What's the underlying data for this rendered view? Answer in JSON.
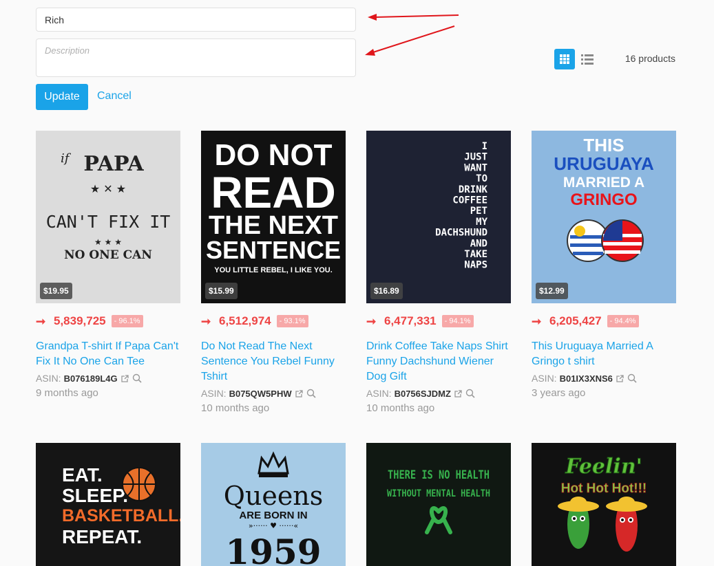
{
  "form": {
    "name_value": "Rich",
    "description_placeholder": "Description",
    "update_label": "Update",
    "cancel_label": "Cancel"
  },
  "toolbar": {
    "grid_icon": "grid-icon",
    "list_icon": "list-icon",
    "product_count": "16 products"
  },
  "colors": {
    "accent": "#1aa3e8",
    "rank_red": "#ee4444",
    "badge_pink": "#f7a8a8",
    "annotation_arrow": "#e0161b"
  },
  "products": [
    {
      "price": "$19.95",
      "rank": "5,839,725",
      "rank_change": "- 96.1%",
      "title": "Grandpa T-shirt If Papa Can't Fix It No One Can Tee",
      "asin_label": "ASIN:",
      "asin": "B076189L4G",
      "time_ago": "9 months ago",
      "art": {
        "if": "if",
        "papa": "PAPA",
        "cant": "CAN'T FIX IT",
        "no_one": "NO ONE CAN"
      }
    },
    {
      "price": "$15.99",
      "rank": "6,512,974",
      "rank_change": "- 93.1%",
      "title": "Do Not Read The Next Sentence You Rebel Funny Tshirt",
      "asin_label": "ASIN:",
      "asin": "B075QW5PHW",
      "time_ago": "10 months ago",
      "art": {
        "l1": "DO NOT",
        "l2": "READ",
        "l3": "THE NEXT",
        "l4": "SENTENCE",
        "l5": "YOU LITTLE REBEL, I LIKE YOU."
      }
    },
    {
      "price": "$16.89",
      "rank": "6,477,331",
      "rank_change": "- 94.1%",
      "title": "Drink Coffee Take Naps Shirt Funny Dachshund Wiener Dog Gift",
      "asin_label": "ASIN:",
      "asin": "B0756SJDMZ",
      "time_ago": "10 months ago",
      "art": {
        "lines": [
          "I",
          "JUST",
          "WANT",
          "TO",
          "DRINK",
          "COFFEE",
          "PET",
          "MY",
          "DACHSHUND",
          "AND",
          "TAKE",
          "NAPS"
        ]
      }
    },
    {
      "price": "$12.99",
      "rank": "6,205,427",
      "rank_change": "- 94.4%",
      "title": "This Uruguaya Married A Gringo t shirt",
      "asin_label": "ASIN:",
      "asin": "B01IX3XNS6",
      "time_ago": "3 years ago",
      "art": {
        "l1": "THIS",
        "l2": "URUGUAYA",
        "l3": "MARRIED A",
        "l4": "GRINGO"
      }
    },
    {
      "art": {
        "l1": "EAT.",
        "l2": "SLEEP.",
        "l3": "BASKETBALL.",
        "l4": "REPEAT."
      }
    },
    {
      "art": {
        "l1": "Queens",
        "l2": "ARE BORN IN",
        "l3": "1959"
      }
    },
    {
      "art": {
        "l1": "THERE IS NO HEALTH",
        "l2": "WITHOUT MENTAL HEALTH"
      }
    },
    {
      "art": {
        "l1": "Feelin'",
        "l2": "Hot Hot Hot!!!"
      }
    }
  ]
}
